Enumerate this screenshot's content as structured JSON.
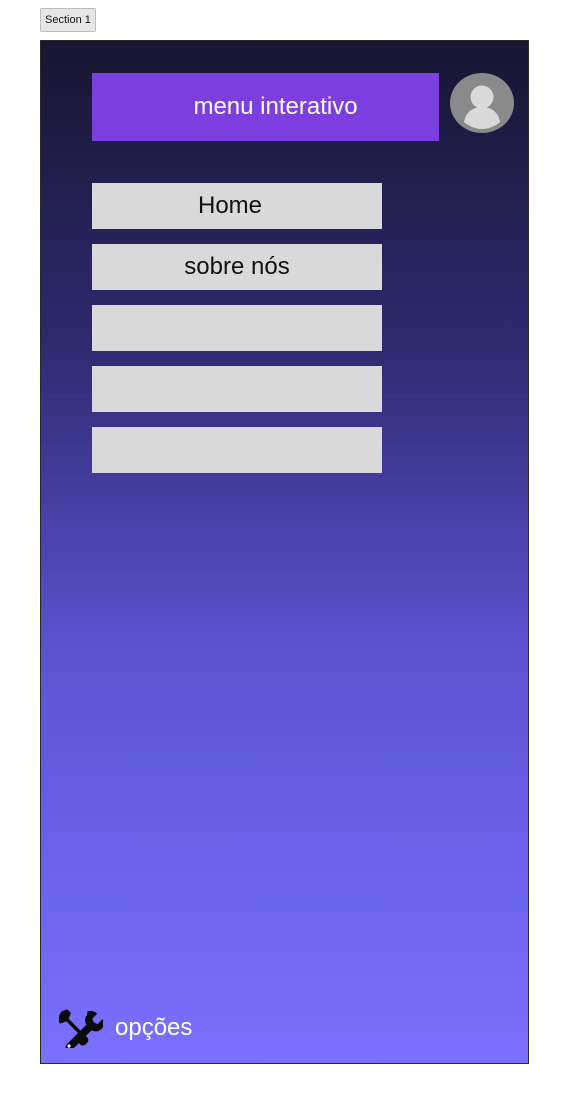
{
  "section_tab": {
    "label": "Section 1"
  },
  "header": {
    "title": "menu interativo",
    "background": "#7b3fe0"
  },
  "avatar": {
    "icon": "user-avatar-icon"
  },
  "menu": {
    "items": [
      {
        "label": "Home"
      },
      {
        "label": "sobre nós"
      },
      {
        "label": ""
      },
      {
        "label": ""
      },
      {
        "label": ""
      }
    ]
  },
  "footer": {
    "options_label": "opções",
    "icon": "tools-icon"
  },
  "colors": {
    "gradient_top": "#171530",
    "gradient_bottom": "#7970ff",
    "menu_item_bg": "#d9d9d9",
    "avatar_bg": "#8a8a8a"
  }
}
